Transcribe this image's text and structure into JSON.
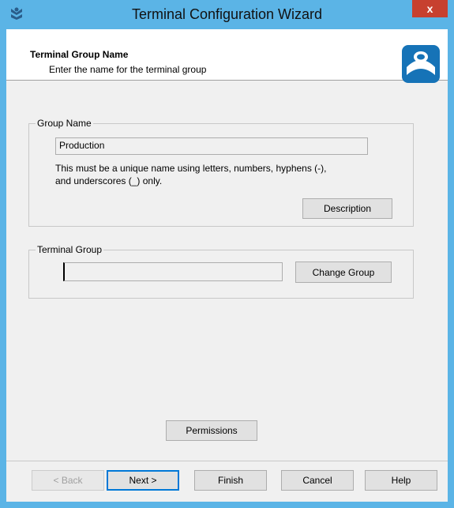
{
  "window": {
    "title": "Terminal Configuration Wizard",
    "close_label": "x",
    "colors": {
      "frame": "#5bb4e6",
      "close": "#c7402f",
      "logo": "#1673b7"
    }
  },
  "header": {
    "title": "Terminal Group Name",
    "subtitle": "Enter the name for the terminal group",
    "logo_icon": "thinmanager-logo-icon"
  },
  "group_name": {
    "legend": "Group Name",
    "value": "Production",
    "note_line1": "This must be a unique name using letters, numbers, hyphens (-),",
    "note_line2": "and underscores (_) only.",
    "description_button": "Description"
  },
  "terminal_group": {
    "legend": "Terminal Group",
    "value": "",
    "change_group_button": "Change Group"
  },
  "permissions_button": "Permissions",
  "footer": {
    "back": "< Back",
    "next": "Next >",
    "finish": "Finish",
    "cancel": "Cancel",
    "help": "Help"
  }
}
